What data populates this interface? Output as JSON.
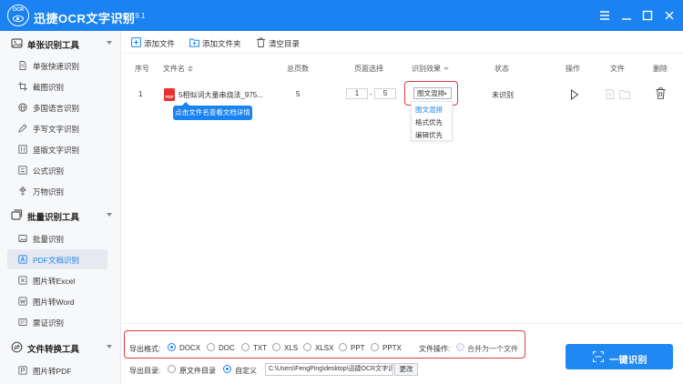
{
  "app": {
    "logo_text": "OCR",
    "title": "迅捷OCR文字识别",
    "version": "v8.7.9.1"
  },
  "colors": {
    "accent": "#1a83f1",
    "highlight": "#e03b3b",
    "pdf_icon": "#e6322f"
  },
  "window_controls": [
    "menu-icon",
    "minimize-icon",
    "maximize-icon",
    "close-icon"
  ],
  "sidebar": {
    "groups": [
      {
        "label": "单张识别工具",
        "icon": "image-icon",
        "items": [
          {
            "label": "单张快速识别",
            "icon": "file-icon"
          },
          {
            "label": "截图识别",
            "icon": "crop-icon"
          },
          {
            "label": "多国语言识别",
            "icon": "globe-icon"
          },
          {
            "label": "手写文字识别",
            "icon": "pen-icon"
          },
          {
            "label": "竖版文字识别",
            "icon": "vertical-text-icon"
          },
          {
            "label": "公式识别",
            "icon": "formula-icon"
          },
          {
            "label": "万物识别",
            "icon": "flower-icon"
          }
        ]
      },
      {
        "label": "批量识别工具",
        "icon": "batch-icon",
        "items": [
          {
            "label": "批量识别",
            "icon": "images-icon"
          },
          {
            "label": "PDF文档识别",
            "icon": "pdf-icon",
            "active": true
          },
          {
            "label": "图片转Excel",
            "icon": "excel-icon"
          },
          {
            "label": "图片转Word",
            "icon": "word-icon"
          },
          {
            "label": "票证识别",
            "icon": "ticket-icon"
          }
        ]
      },
      {
        "label": "文件转换工具",
        "icon": "convert-icon",
        "items": [
          {
            "label": "图片转PDF",
            "icon": "image-pdf-icon"
          }
        ]
      }
    ]
  },
  "toolbar": {
    "add_file": "添加文件",
    "add_folder": "添加文件夹",
    "clear_list": "清空目录"
  },
  "table": {
    "headers": {
      "index": "序号",
      "filename": "文件名",
      "pages": "总页数",
      "page_select": "页面选择",
      "effect": "识别效果",
      "status": "状态",
      "action": "操作",
      "file": "文件",
      "delete": "删除"
    },
    "rows": [
      {
        "index": "1",
        "filename": "5相似词大量串烧法_975...",
        "pages": "5",
        "page_from": "1",
        "page_sep": "-",
        "page_to": "5",
        "effect": "图文混排",
        "status": "未识别"
      }
    ],
    "tooltip": "点击文件名查看文档详情",
    "effect_options": [
      "图文混排",
      "格式优先",
      "编辑优先"
    ],
    "effect_selected": "图文混排"
  },
  "bottom": {
    "format_label": "导出格式:",
    "formats": [
      "DOCX",
      "DOC",
      "TXT",
      "XLS",
      "XLSX",
      "PPT",
      "PPTX"
    ],
    "format_selected": "DOCX",
    "file_op_label": "文件操作:",
    "merge_label": "合并为一个文件",
    "dir_label": "导出目录:",
    "dir_options": [
      "原文件目录",
      "自定义"
    ],
    "dir_selected": "自定义",
    "path": "C:\\Users\\FengPing\\desktop\\迅捷OCR文字识",
    "change_label": "更改",
    "ocr_button": "一键识别"
  }
}
